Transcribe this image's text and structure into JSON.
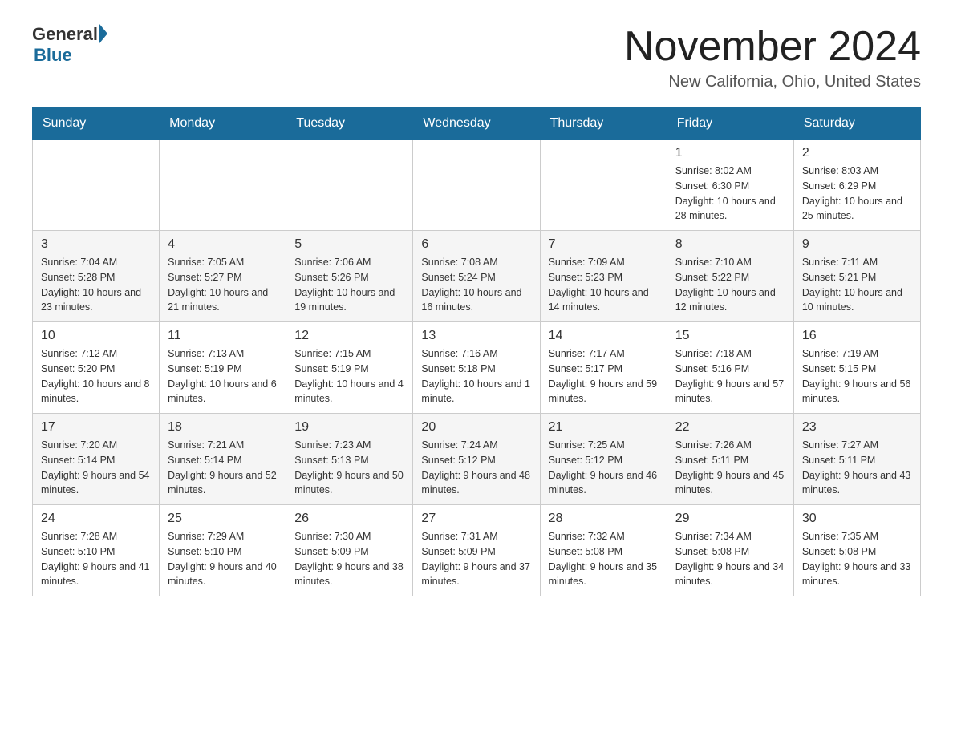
{
  "logo": {
    "general": "General",
    "blue": "Blue"
  },
  "title": "November 2024",
  "location": "New California, Ohio, United States",
  "weekdays": [
    "Sunday",
    "Monday",
    "Tuesday",
    "Wednesday",
    "Thursday",
    "Friday",
    "Saturday"
  ],
  "rows": [
    [
      {
        "day": "",
        "info": ""
      },
      {
        "day": "",
        "info": ""
      },
      {
        "day": "",
        "info": ""
      },
      {
        "day": "",
        "info": ""
      },
      {
        "day": "",
        "info": ""
      },
      {
        "day": "1",
        "info": "Sunrise: 8:02 AM\nSunset: 6:30 PM\nDaylight: 10 hours and 28 minutes."
      },
      {
        "day": "2",
        "info": "Sunrise: 8:03 AM\nSunset: 6:29 PM\nDaylight: 10 hours and 25 minutes."
      }
    ],
    [
      {
        "day": "3",
        "info": "Sunrise: 7:04 AM\nSunset: 5:28 PM\nDaylight: 10 hours and 23 minutes."
      },
      {
        "day": "4",
        "info": "Sunrise: 7:05 AM\nSunset: 5:27 PM\nDaylight: 10 hours and 21 minutes."
      },
      {
        "day": "5",
        "info": "Sunrise: 7:06 AM\nSunset: 5:26 PM\nDaylight: 10 hours and 19 minutes."
      },
      {
        "day": "6",
        "info": "Sunrise: 7:08 AM\nSunset: 5:24 PM\nDaylight: 10 hours and 16 minutes."
      },
      {
        "day": "7",
        "info": "Sunrise: 7:09 AM\nSunset: 5:23 PM\nDaylight: 10 hours and 14 minutes."
      },
      {
        "day": "8",
        "info": "Sunrise: 7:10 AM\nSunset: 5:22 PM\nDaylight: 10 hours and 12 minutes."
      },
      {
        "day": "9",
        "info": "Sunrise: 7:11 AM\nSunset: 5:21 PM\nDaylight: 10 hours and 10 minutes."
      }
    ],
    [
      {
        "day": "10",
        "info": "Sunrise: 7:12 AM\nSunset: 5:20 PM\nDaylight: 10 hours and 8 minutes."
      },
      {
        "day": "11",
        "info": "Sunrise: 7:13 AM\nSunset: 5:19 PM\nDaylight: 10 hours and 6 minutes."
      },
      {
        "day": "12",
        "info": "Sunrise: 7:15 AM\nSunset: 5:19 PM\nDaylight: 10 hours and 4 minutes."
      },
      {
        "day": "13",
        "info": "Sunrise: 7:16 AM\nSunset: 5:18 PM\nDaylight: 10 hours and 1 minute."
      },
      {
        "day": "14",
        "info": "Sunrise: 7:17 AM\nSunset: 5:17 PM\nDaylight: 9 hours and 59 minutes."
      },
      {
        "day": "15",
        "info": "Sunrise: 7:18 AM\nSunset: 5:16 PM\nDaylight: 9 hours and 57 minutes."
      },
      {
        "day": "16",
        "info": "Sunrise: 7:19 AM\nSunset: 5:15 PM\nDaylight: 9 hours and 56 minutes."
      }
    ],
    [
      {
        "day": "17",
        "info": "Sunrise: 7:20 AM\nSunset: 5:14 PM\nDaylight: 9 hours and 54 minutes."
      },
      {
        "day": "18",
        "info": "Sunrise: 7:21 AM\nSunset: 5:14 PM\nDaylight: 9 hours and 52 minutes."
      },
      {
        "day": "19",
        "info": "Sunrise: 7:23 AM\nSunset: 5:13 PM\nDaylight: 9 hours and 50 minutes."
      },
      {
        "day": "20",
        "info": "Sunrise: 7:24 AM\nSunset: 5:12 PM\nDaylight: 9 hours and 48 minutes."
      },
      {
        "day": "21",
        "info": "Sunrise: 7:25 AM\nSunset: 5:12 PM\nDaylight: 9 hours and 46 minutes."
      },
      {
        "day": "22",
        "info": "Sunrise: 7:26 AM\nSunset: 5:11 PM\nDaylight: 9 hours and 45 minutes."
      },
      {
        "day": "23",
        "info": "Sunrise: 7:27 AM\nSunset: 5:11 PM\nDaylight: 9 hours and 43 minutes."
      }
    ],
    [
      {
        "day": "24",
        "info": "Sunrise: 7:28 AM\nSunset: 5:10 PM\nDaylight: 9 hours and 41 minutes."
      },
      {
        "day": "25",
        "info": "Sunrise: 7:29 AM\nSunset: 5:10 PM\nDaylight: 9 hours and 40 minutes."
      },
      {
        "day": "26",
        "info": "Sunrise: 7:30 AM\nSunset: 5:09 PM\nDaylight: 9 hours and 38 minutes."
      },
      {
        "day": "27",
        "info": "Sunrise: 7:31 AM\nSunset: 5:09 PM\nDaylight: 9 hours and 37 minutes."
      },
      {
        "day": "28",
        "info": "Sunrise: 7:32 AM\nSunset: 5:08 PM\nDaylight: 9 hours and 35 minutes."
      },
      {
        "day": "29",
        "info": "Sunrise: 7:34 AM\nSunset: 5:08 PM\nDaylight: 9 hours and 34 minutes."
      },
      {
        "day": "30",
        "info": "Sunrise: 7:35 AM\nSunset: 5:08 PM\nDaylight: 9 hours and 33 minutes."
      }
    ]
  ]
}
